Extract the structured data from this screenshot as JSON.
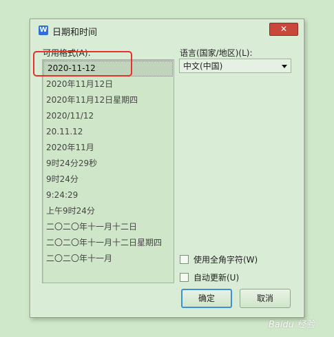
{
  "dialog": {
    "title": "日期和时间",
    "app_icon": "W",
    "close": "✕"
  },
  "formats": {
    "label": "可用格式(A):",
    "items": [
      "2020-11-12",
      "2020年11月12日",
      "2020年11月12日星期四",
      "2020/11/12",
      "20.11.12",
      "2020年11月",
      "9时24分29秒",
      "9时24分",
      "9:24:29",
      "上午9时24分",
      "二〇二〇年十一月十二日",
      "二〇二〇年十一月十二日星期四",
      "二〇二〇年十一月"
    ],
    "selected_index": 0
  },
  "language": {
    "label": "语言(国家/地区)(L):",
    "selected": "中文(中国)"
  },
  "options": {
    "fullwidth_label": "使用全角字符(W)",
    "fullwidth_checked": false,
    "autoupdate_label": "自动更新(U)",
    "autoupdate_checked": false
  },
  "buttons": {
    "ok": "确定",
    "cancel": "取消"
  },
  "watermark": "Baidu 经验",
  "colors": {
    "annotation_box": "#e8302a",
    "close_button": "#c9473b",
    "primary_focus": "#3c8fd8"
  }
}
